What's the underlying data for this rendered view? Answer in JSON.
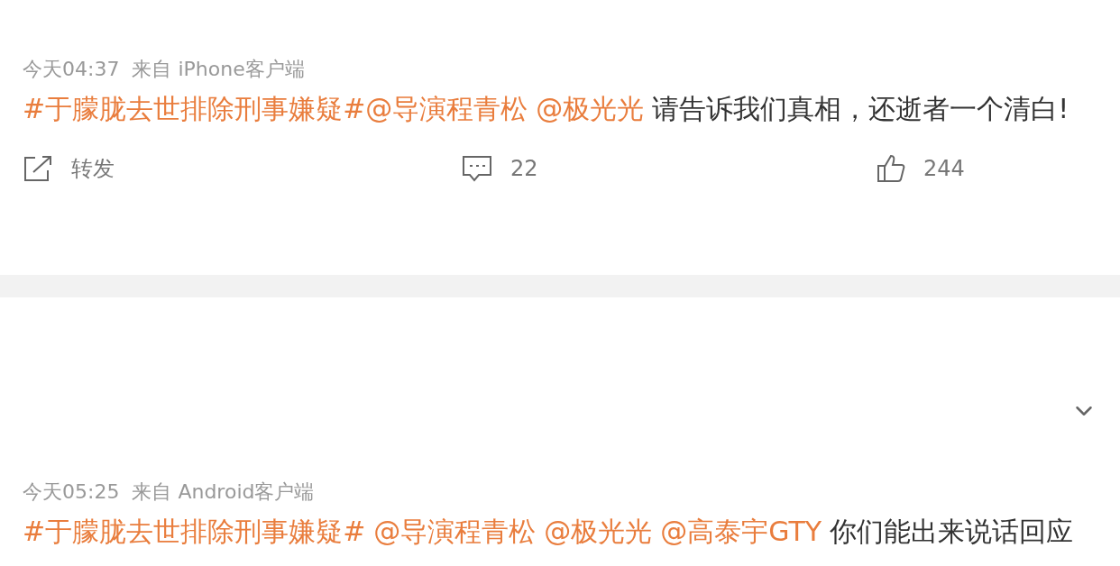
{
  "posts": [
    {
      "time": "今天04:37",
      "source": "来自 iPhone客户端",
      "segments": [
        {
          "kind": "topic",
          "text": "#于朦胧去世排除刑事嫌疑#"
        },
        {
          "kind": "mention",
          "text": "@导演程青松",
          "space_before": false
        },
        {
          "kind": "mention",
          "text": "@极光光",
          "space_before": true
        },
        {
          "kind": "text",
          "text": "请告诉我们真相，还逝者一个清白!",
          "space_before": true
        }
      ],
      "actions": [
        {
          "kind": "repost",
          "label": "转发"
        },
        {
          "kind": "comment",
          "label": "22"
        },
        {
          "kind": "like",
          "label": "244"
        }
      ]
    },
    {
      "time": "今天05:25",
      "source": "来自 Android客户端",
      "segments": [
        {
          "kind": "topic",
          "text": "#于朦胧去世排除刑事嫌疑#"
        },
        {
          "kind": "mention",
          "text": "@导演程青松",
          "space_before": true
        },
        {
          "kind": "mention",
          "text": "@极光光",
          "space_before": true
        },
        {
          "kind": "mention",
          "text": "@高泰宇GTY",
          "space_before": true
        },
        {
          "kind": "text",
          "text": "你们能出来说话回应",
          "space_before": true
        }
      ]
    }
  ]
}
